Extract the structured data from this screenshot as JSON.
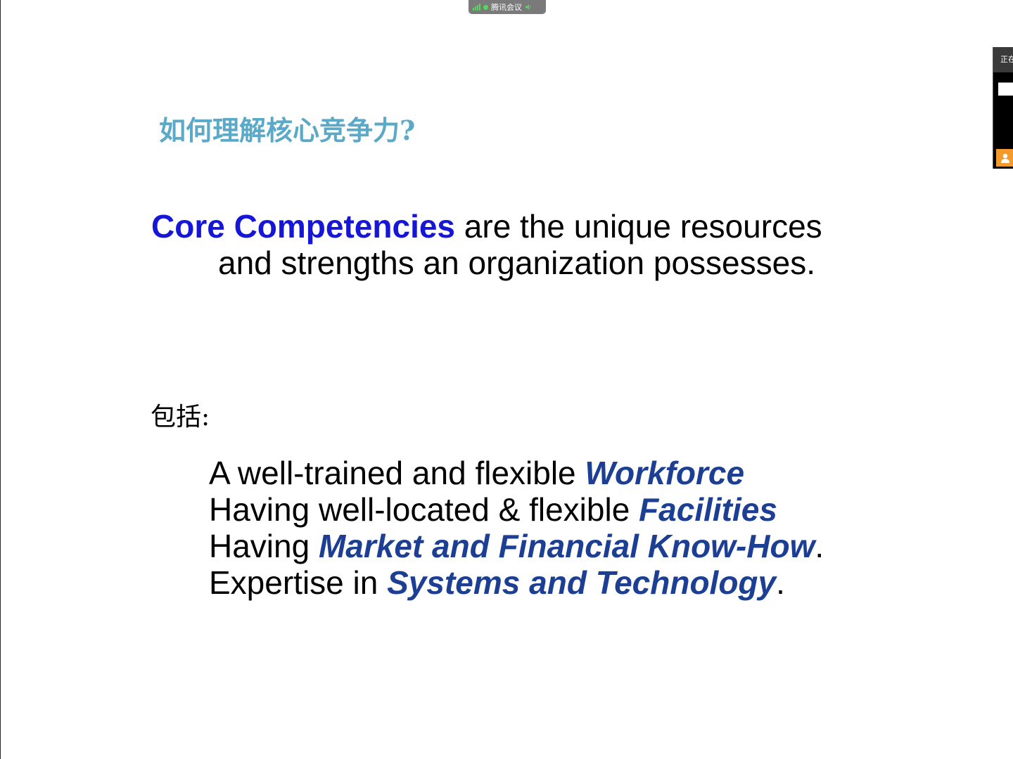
{
  "meeting_bar": {
    "app_name": "腾讯会议",
    "signal_icon": "signal-bars-icon",
    "status_icon": "connected-dot-icon",
    "audio_icon": "speaker-icon",
    "accent": "#55d85a"
  },
  "side_panel": {
    "header_text": "正在",
    "avatar_icon": "person-icon",
    "avatar_color": "#f39a2c"
  },
  "slide": {
    "title": "如何理解核心竞争力?",
    "title_color": "#5ba9c8",
    "definition": {
      "term": "Core Competencies",
      "line1_rest": " are the unique resources",
      "line2": "and strengths an organization possesses.",
      "term_color": "#1616d6"
    },
    "includes_label": "包括:",
    "items": [
      {
        "prefix": "A well-trained and flexible ",
        "emphasis": "Workforce",
        "suffix": ""
      },
      {
        "prefix": "Having well-located & flexible ",
        "emphasis": "Facilities",
        "suffix": ""
      },
      {
        "prefix": "Having ",
        "emphasis": "Market and Financial Know-How",
        "suffix": "."
      },
      {
        "prefix": "Expertise in ",
        "emphasis": "Systems and Technology",
        "suffix": "."
      }
    ],
    "emphasis_color": "#1c3f94"
  }
}
